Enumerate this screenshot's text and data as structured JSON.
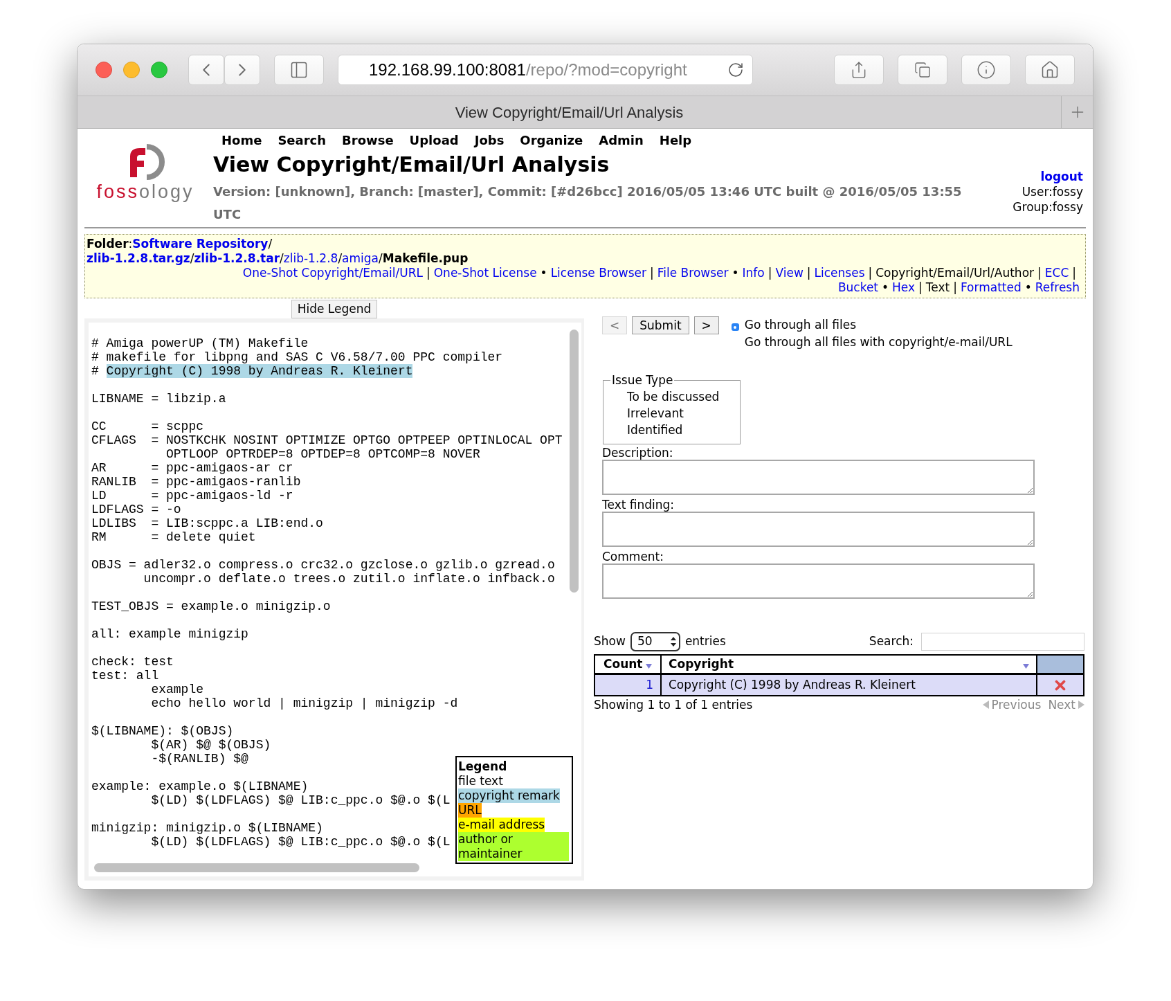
{
  "browser": {
    "url_host": "192.168.99.100:8081",
    "url_path": "/repo/?mod=copyright",
    "tab_title": "View Copyright/Email/Url Analysis"
  },
  "logo": {
    "text_accent": "foss",
    "text_rest": "ology"
  },
  "nav_menu": [
    "Home",
    "Search",
    "Browse",
    "Upload",
    "Jobs",
    "Organize",
    "Admin",
    "Help"
  ],
  "page_title": "View Copyright/Email/Url Analysis",
  "version_info": "Version: [unknown], Branch: [master], Commit: [#d26bcc] 2016/05/05 13:46 UTC built @ 2016/05/05 13:55 UTC",
  "user_box": {
    "logout": "logout",
    "user": "User:fossy",
    "group": "Group:fossy"
  },
  "folder_lines": [
    [
      {
        "text": "Folder",
        "kind": "label"
      },
      {
        "text": ":",
        "kind": "text"
      },
      {
        "text": "Software Repository",
        "kind": "link",
        "bold": true
      },
      {
        "text": "/",
        "kind": "text"
      }
    ],
    [
      {
        "text": "zlib-1.2.8.tar.gz",
        "kind": "link",
        "bold": true
      },
      {
        "text": "/",
        "kind": "text"
      },
      {
        "text": "zlib-1.2.8.tar",
        "kind": "link",
        "bold": true
      },
      {
        "text": "/",
        "kind": "text"
      },
      {
        "text": "zlib-1.2.8",
        "kind": "link",
        "bold": false
      },
      {
        "text": "/",
        "kind": "text"
      },
      {
        "text": "amiga",
        "kind": "link",
        "bold": false
      },
      {
        "text": "/",
        "kind": "text"
      },
      {
        "text": "Makefile.pup",
        "kind": "label"
      }
    ]
  ],
  "action_rows": [
    [
      {
        "text": "One-Shot Copyright/Email/URL",
        "kind": "link"
      },
      {
        "text": "|",
        "kind": "sep"
      },
      {
        "text": "One-Shot License",
        "kind": "link"
      },
      {
        "text": "•",
        "kind": "sep"
      },
      {
        "text": "License Browser",
        "kind": "link"
      },
      {
        "text": "|",
        "kind": "sep"
      },
      {
        "text": "File Browser",
        "kind": "link"
      },
      {
        "text": "•",
        "kind": "sep"
      },
      {
        "text": "Info",
        "kind": "link"
      },
      {
        "text": "|",
        "kind": "sep"
      },
      {
        "text": "View",
        "kind": "link"
      },
      {
        "text": "|",
        "kind": "sep"
      },
      {
        "text": "Licenses",
        "kind": "link"
      },
      {
        "text": "|",
        "kind": "sep"
      },
      {
        "text": "Copyright/Email/Url/Author",
        "kind": "current"
      },
      {
        "text": "|",
        "kind": "sep"
      },
      {
        "text": "ECC",
        "kind": "link"
      },
      {
        "text": "|",
        "kind": "sep"
      }
    ],
    [
      {
        "text": "Bucket",
        "kind": "link"
      },
      {
        "text": "•",
        "kind": "sep"
      },
      {
        "text": "Hex",
        "kind": "link"
      },
      {
        "text": "|",
        "kind": "sep"
      },
      {
        "text": "Text",
        "kind": "current"
      },
      {
        "text": "|",
        "kind": "sep"
      },
      {
        "text": "Formatted",
        "kind": "link"
      },
      {
        "text": "•",
        "kind": "sep"
      },
      {
        "text": "Refresh",
        "kind": "link"
      }
    ]
  ],
  "hide_legend_button": "Hide Legend",
  "code_blocks": [
    [
      {
        "text": "# Amiga powerUP (TM) Makefile"
      },
      {
        "text": "# makefile for libpng and SAS C V6.58/7.00 PPC compiler"
      },
      {
        "prefix": "# ",
        "highlight": "Copyright (C) 1998 by Andreas R. Kleinert",
        "color": "#add8e6"
      }
    ],
    [
      {
        "text": "LIBNAME = libzip.a"
      }
    ],
    [
      {
        "text": "CC      = scppc"
      },
      {
        "text": "CFLAGS  = NOSTKCHK NOSINT OPTIMIZE OPTGO OPTPEEP OPTINLOCAL OPT"
      },
      {
        "text": "          OPTLOOP OPTRDEP=8 OPTDEP=8 OPTCOMP=8 NOVER"
      },
      {
        "text": "AR      = ppc-amigaos-ar cr"
      },
      {
        "text": "RANLIB  = ppc-amigaos-ranlib"
      },
      {
        "text": "LD      = ppc-amigaos-ld -r"
      },
      {
        "text": "LDFLAGS = -o"
      },
      {
        "text": "LDLIBS  = LIB:scppc.a LIB:end.o"
      },
      {
        "text": "RM      = delete quiet"
      }
    ],
    [
      {
        "text": "OBJS = adler32.o compress.o crc32.o gzclose.o gzlib.o gzread.o"
      },
      {
        "text": "       uncompr.o deflate.o trees.o zutil.o inflate.o infback.o"
      }
    ],
    [
      {
        "text": "TEST_OBJS = example.o minigzip.o"
      }
    ],
    [
      {
        "text": "all: example minigzip"
      }
    ],
    [
      {
        "text": "check: test"
      },
      {
        "text": "test: all"
      },
      {
        "text": "        example"
      },
      {
        "text": "        echo hello world | minigzip | minigzip -d"
      }
    ],
    [
      {
        "text": "$(LIBNAME): $(OBJS)"
      },
      {
        "text": "        $(AR) $@ $(OBJS)"
      },
      {
        "text": "        -$(RANLIB) $@"
      }
    ],
    [
      {
        "text": "example: example.o $(LIBNAME)"
      },
      {
        "text": "        $(LD) $(LDFLAGS) $@ LIB:c_ppc.o $@.o $(L"
      }
    ],
    [
      {
        "text": "minigzip: minigzip.o $(LIBNAME)"
      },
      {
        "text": "        $(LD) $(LDFLAGS) $@ LIB:c_ppc.o $@.o $(L"
      }
    ]
  ],
  "legend": {
    "title": "Legend",
    "items": [
      {
        "text": "file text",
        "color": "#ffffff"
      },
      {
        "text": "copyright remark",
        "color": "#add8e6"
      },
      {
        "text": "URL",
        "color": "#ffa500"
      },
      {
        "text": "e-mail address",
        "color": "#ffff00"
      },
      {
        "text": "author or maintainer",
        "color": "#adff2f"
      }
    ]
  },
  "nav_buttons": [
    {
      "label": "<",
      "disabled": true
    },
    {
      "label": "Submit",
      "disabled": false
    },
    {
      "label": ">",
      "disabled": false
    }
  ],
  "scan_options": [
    {
      "label": "Go through all files",
      "selected": true
    },
    {
      "label": "Go through all files with copyright/e-mail/URL",
      "selected": false
    }
  ],
  "issue_type": {
    "legend": "Issue Type",
    "options": [
      "To be discussed",
      "Irrelevant",
      "Identified"
    ]
  },
  "text_areas": [
    {
      "label": "Description:"
    },
    {
      "label": "Text finding:"
    },
    {
      "label": "Comment:"
    }
  ],
  "table": {
    "show_label": "Show",
    "page_size": "50",
    "entries_label": "entries",
    "search_label": "Search:",
    "columns": [
      "Count",
      "Copyright"
    ],
    "rows": [
      {
        "count": "1",
        "copyright": "Copyright (C) 1998 by Andreas R. Kleinert"
      }
    ],
    "info": "Showing 1 to 1 of 1 entries",
    "pagination": [
      {
        "label": "Previous",
        "disabled": true
      },
      {
        "label": "Next",
        "disabled": true
      }
    ]
  }
}
